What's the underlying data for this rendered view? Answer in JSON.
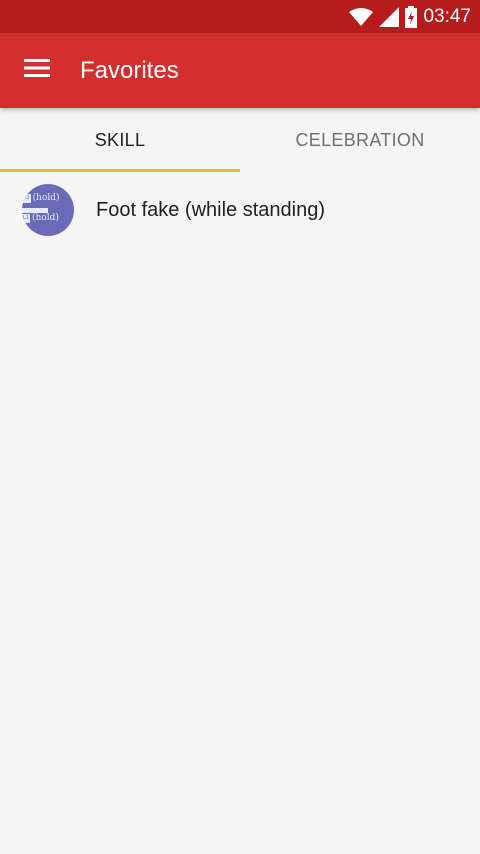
{
  "status_bar": {
    "time": "03:47",
    "icons": [
      "wifi-icon",
      "cell-signal-icon",
      "battery-charging-icon"
    ]
  },
  "app_bar": {
    "title": "Favorites",
    "menu_icon": "hamburger-menu-icon"
  },
  "tabs": [
    {
      "label": "SKILL",
      "active": true
    },
    {
      "label": "CELEBRATION",
      "active": false
    }
  ],
  "list": {
    "items": [
      {
        "label": "Foot fake (while standing)",
        "icon": {
          "row1_button": "R1",
          "row1_text": "(hold)",
          "row2_button": "L1",
          "row2_text": "(hold)"
        }
      }
    ]
  },
  "colors": {
    "status_bar": "#b71c1c",
    "app_bar": "#d32f2f",
    "tab_indicator": "#f5b335",
    "avatar_bg": "#6a6ab8",
    "background": "#f5f5f5"
  }
}
